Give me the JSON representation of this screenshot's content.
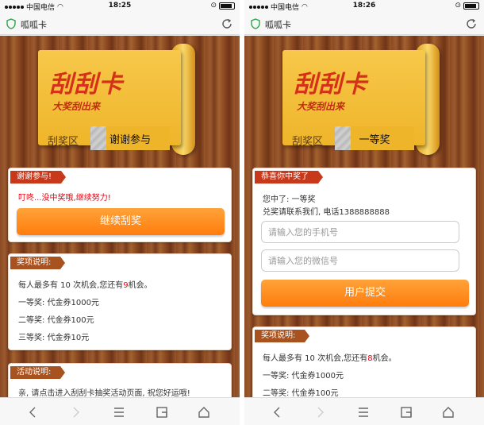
{
  "status": {
    "carrier": "中国电信",
    "left_time": "18:25",
    "right_time": "18:26"
  },
  "tab_title": "呱呱卡",
  "banner": {
    "logo": "刮刮卡",
    "slogan": "大奖刮出来",
    "zone_label": "刮奖区"
  },
  "left": {
    "result_text": "谢谢参与",
    "card1": {
      "tag": "谢谢参与!",
      "message": "叮咚...没中奖哦,继续努力!",
      "button": "继续刮奖"
    },
    "rules": {
      "tag": "奖项说明:",
      "line1_prefix": "每人最多有 10 次机会,您还有",
      "line1_count": "9",
      "line1_suffix": "机会。",
      "prizes": [
        "一等奖: 代金券1000元",
        "二等奖: 代金券100元",
        "三等奖: 代金券10元"
      ]
    },
    "activity": {
      "tag": "活动说明:",
      "text": "亲, 请点击进入刮刮卡抽奖活动页面, 祝您好运哦!"
    }
  },
  "right": {
    "result_text": "一等奖",
    "card1": {
      "tag": "恭喜你中奖了",
      "won_label": "您中了: 一等奖",
      "contact": "兑奖请联系我们, 电话1388888888",
      "phone_placeholder": "请输入您的手机号",
      "wechat_placeholder": "请输入您的微信号",
      "button": "用户提交"
    },
    "rules": {
      "tag": "奖项说明:",
      "line1_prefix": "每人最多有 10 次机会,您还有",
      "line1_count": "8",
      "line1_suffix": "机会。",
      "prizes": [
        "一等奖: 代金券1000元",
        "二等奖: 代金券100元"
      ]
    }
  },
  "colors": {
    "accent": "#ff8a1a",
    "tag_red": "#c8391c",
    "tag_brown": "#a8521f",
    "highlight": "#e60012"
  },
  "icons": [
    "shield-icon",
    "reload-icon",
    "back-icon",
    "forward-icon",
    "menu-icon",
    "tabs-icon",
    "home-icon"
  ]
}
